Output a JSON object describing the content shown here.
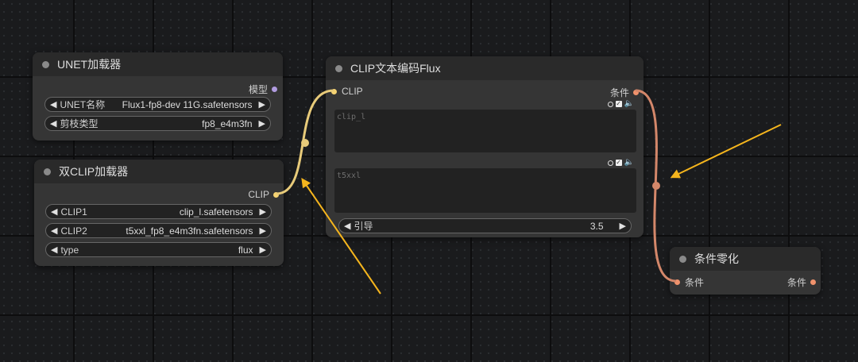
{
  "nodes": {
    "unet": {
      "title": "UNET加载器",
      "output": "模型",
      "widgets": [
        {
          "label": "UNET名称",
          "value": "Flux1-fp8-dev 11G.safetensors"
        },
        {
          "label": "剪枝类型",
          "value": "fp8_e4m3fn"
        }
      ]
    },
    "dual_clip": {
      "title": "双CLIP加载器",
      "output": "CLIP",
      "widgets": [
        {
          "label": "CLIP1",
          "value": "clip_l.safetensors"
        },
        {
          "label": "CLIP2",
          "value": "t5xxl_fp8_e4m3fn.safetensors"
        },
        {
          "label": "type",
          "value": "flux"
        }
      ]
    },
    "clip_text": {
      "title": "CLIP文本编码Flux",
      "input": "CLIP",
      "output": "条件",
      "text_fields": [
        {
          "placeholder": "clip_l"
        },
        {
          "placeholder": "t5xxl"
        }
      ],
      "guidance": {
        "label": "引导",
        "value": "3.5"
      }
    },
    "cond_zero": {
      "title": "条件零化",
      "input": "条件",
      "output": "条件"
    }
  },
  "glyphs": {
    "left_arrow": "◀",
    "right_arrow": "▶",
    "check": "✓",
    "speaker": "🔈"
  },
  "colors": {
    "model_slot": "#b19ce0",
    "clip_slot": "#f5d372",
    "cond_slot": "#f0926c",
    "clip_wire": "#e8cb7a",
    "cond_wire": "#d4876a",
    "annotation_arrow": "#f5b51d"
  }
}
